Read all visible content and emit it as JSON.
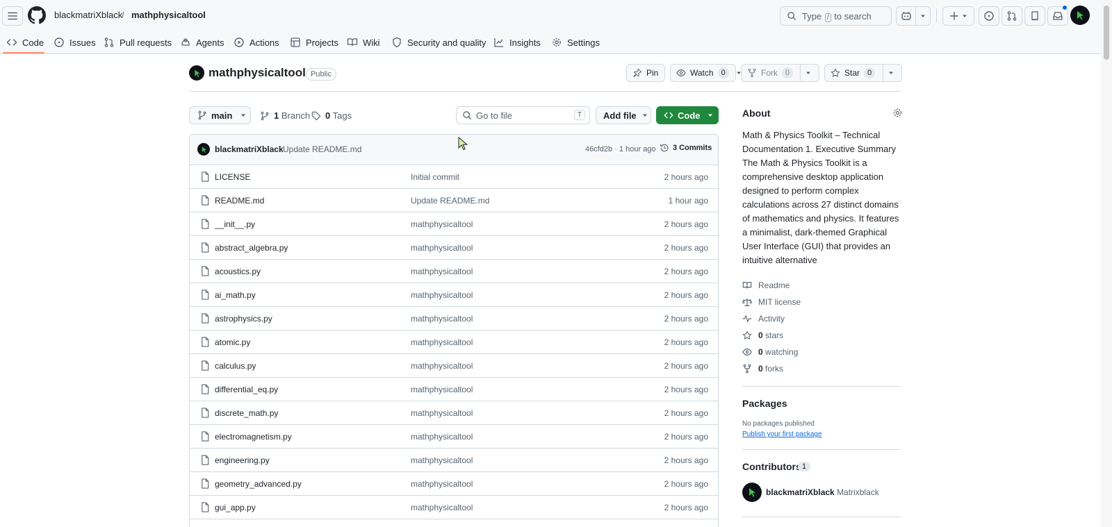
{
  "header": {
    "owner": "blackmatriXblack",
    "separator": "/",
    "repo": "mathphysicaltool",
    "search": {
      "pre": "Type",
      "key": "/",
      "post": "to search"
    }
  },
  "tabs": [
    {
      "label": "Code",
      "icon": "code-icon"
    },
    {
      "label": "Issues",
      "icon": "issue-opened-icon"
    },
    {
      "label": "Pull requests",
      "icon": "git-pull-request-icon"
    },
    {
      "label": "Agents",
      "icon": "agent-icon"
    },
    {
      "label": "Actions",
      "icon": "play-icon"
    },
    {
      "label": "Projects",
      "icon": "table-icon"
    },
    {
      "label": "Wiki",
      "icon": "book-icon"
    },
    {
      "label": "Security and quality",
      "icon": "shield-icon"
    },
    {
      "label": "Insights",
      "icon": "graph-icon"
    },
    {
      "label": "Settings",
      "icon": "gear-icon"
    }
  ],
  "repo_header": {
    "name": "mathphysicaltool",
    "visibility": "Public",
    "pin": "Pin",
    "watch": {
      "label": "Watch",
      "count": "0"
    },
    "fork": {
      "label": "Fork",
      "count": "0"
    },
    "star": {
      "label": "Star",
      "count": "0"
    }
  },
  "toolbar": {
    "branch": "main",
    "branches_count": "1",
    "branches_label": "Branch",
    "tags_count": "0",
    "tags_label": "Tags",
    "go_to_file": "Go to file",
    "go_to_file_key": "T",
    "add_file": "Add file",
    "code": "Code"
  },
  "latest_commit": {
    "author": "blackmatriXblack",
    "message": "Update README.md",
    "hash_time": "46cfd2b · 1 hour ago",
    "commits": "3 Commits"
  },
  "files": [
    {
      "name": "LICENSE",
      "message": "Initial commit",
      "time": "2 hours ago"
    },
    {
      "name": "README.md",
      "message": "Update README.md",
      "time": "1 hour ago"
    },
    {
      "name": "__init__.py",
      "message": "mathphysicaltool",
      "time": "2 hours ago"
    },
    {
      "name": "abstract_algebra.py",
      "message": "mathphysicaltool",
      "time": "2 hours ago"
    },
    {
      "name": "acoustics.py",
      "message": "mathphysicaltool",
      "time": "2 hours ago"
    },
    {
      "name": "ai_math.py",
      "message": "mathphysicaltool",
      "time": "2 hours ago"
    },
    {
      "name": "astrophysics.py",
      "message": "mathphysicaltool",
      "time": "2 hours ago"
    },
    {
      "name": "atomic.py",
      "message": "mathphysicaltool",
      "time": "2 hours ago"
    },
    {
      "name": "calculus.py",
      "message": "mathphysicaltool",
      "time": "2 hours ago"
    },
    {
      "name": "differential_eq.py",
      "message": "mathphysicaltool",
      "time": "2 hours ago"
    },
    {
      "name": "discrete_math.py",
      "message": "mathphysicaltool",
      "time": "2 hours ago"
    },
    {
      "name": "electromagnetism.py",
      "message": "mathphysicaltool",
      "time": "2 hours ago"
    },
    {
      "name": "engineering.py",
      "message": "mathphysicaltool",
      "time": "2 hours ago"
    },
    {
      "name": "geometry_advanced.py",
      "message": "mathphysicaltool",
      "time": "2 hours ago"
    },
    {
      "name": "gui_app.py",
      "message": "mathphysicaltool",
      "time": "2 hours ago"
    }
  ],
  "about": {
    "title": "About",
    "description": "Math & Physics Toolkit – Technical Documentation 1. Executive Summary The Math & Physics Toolkit is a comprehensive desktop application designed to perform complex calculations across 27 distinct domains of mathematics and physics. It features a minimalist, dark-themed Graphical User Interface (GUI) that provides an intuitive alternative",
    "readme": "Readme",
    "license": "MIT license",
    "activity": "Activity",
    "stars_count": "0",
    "stars_label": "stars",
    "watching_count": "0",
    "watching_label": "watching",
    "forks_count": "0",
    "forks_label": "forks"
  },
  "packages": {
    "title": "Packages",
    "note": "No packages published",
    "link": "Publish your first package"
  },
  "contributors": {
    "title": "Contributors",
    "count": "1",
    "name": "blackmatriXblack",
    "display": "Matrixblack"
  },
  "colors": {
    "accent_green": "#1f883d",
    "link_blue": "#0969da",
    "tab_underline": "#fd8c73",
    "header_bg": "#f6f8fa"
  }
}
